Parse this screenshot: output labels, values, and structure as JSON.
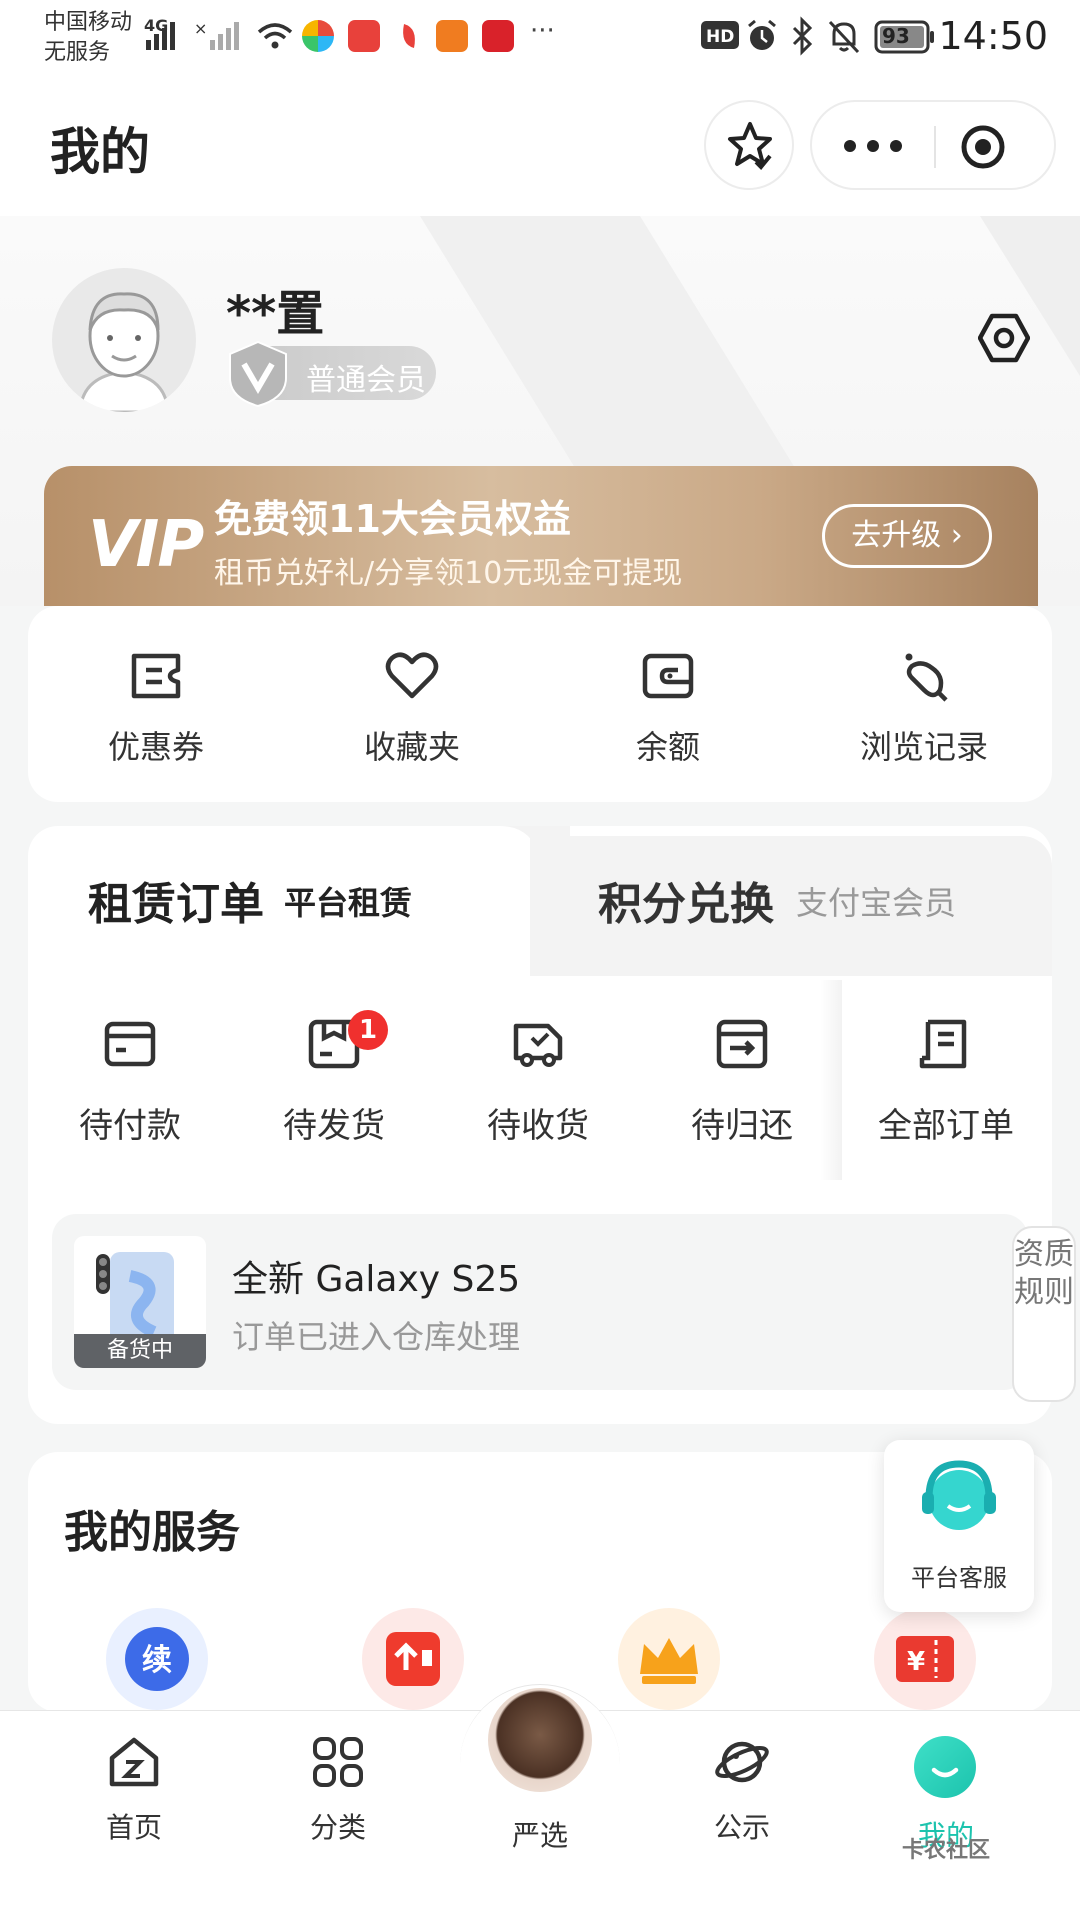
{
  "status_bar": {
    "carrier_line1": "中国移动",
    "carrier_line2": "无服务",
    "network": "4G",
    "battery": "93",
    "time": "14:50"
  },
  "header": {
    "title": "我的"
  },
  "profile": {
    "username": "**置",
    "member_level": "普通会员"
  },
  "vip_banner": {
    "logo": "VIP",
    "title": "免费领11大会员权益",
    "subtitle": "租币兑好礼/分享领10元现金可提现",
    "button": "去升级 ›"
  },
  "quick_links": [
    {
      "label": "优惠券",
      "icon": "coupon-icon"
    },
    {
      "label": "收藏夹",
      "icon": "heart-icon"
    },
    {
      "label": "余额",
      "icon": "wallet-icon"
    },
    {
      "label": "浏览记录",
      "icon": "footprint-icon"
    }
  ],
  "orders": {
    "tab_active": "租赁订单",
    "tab_active_sub": "平台租赁",
    "tab_other": "积分兑换",
    "tab_other_sub": "支付宝会员",
    "statuses": [
      {
        "label": "待付款",
        "icon": "card-icon"
      },
      {
        "label": "待发货",
        "icon": "package-icon",
        "badge": "1"
      },
      {
        "label": "待收货",
        "icon": "truck-icon"
      },
      {
        "label": "待归还",
        "icon": "return-icon"
      },
      {
        "label": "全部订单",
        "icon": "order-list-icon"
      }
    ],
    "recent": {
      "tag": "备货中",
      "name": "全新 Galaxy S25",
      "status": "订单已进入仓库处理"
    },
    "side_tab": "资质规则"
  },
  "services": {
    "title": "我的服务",
    "icons": [
      "renew-icon",
      "upload-icon",
      "crown-icon",
      "ticket-icon"
    ],
    "renew_glyph": "续",
    "ticket_glyph": "¥"
  },
  "customer_service": {
    "label": "平台客服"
  },
  "tab_bar": [
    {
      "label": "首页",
      "icon": "home-icon"
    },
    {
      "label": "分类",
      "icon": "grid-icon"
    },
    {
      "label": "严选",
      "icon": "featured-icon"
    },
    {
      "label": "公示",
      "icon": "planet-icon"
    },
    {
      "label": "我的",
      "icon": "me-icon",
      "active": true
    }
  ],
  "watermark": "卡农社区",
  "colors": {
    "accent": "#1cc3ad",
    "badge_red": "#f0302e",
    "vip_gold": "#c9a882"
  }
}
